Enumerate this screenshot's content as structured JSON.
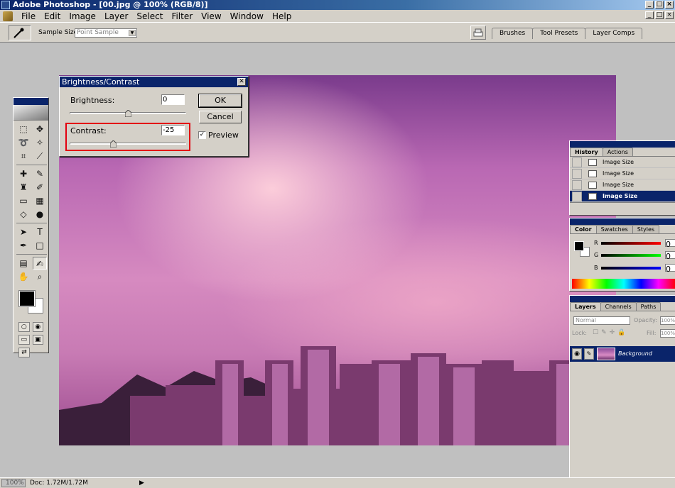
{
  "app": {
    "title": "Adobe Photoshop - [00.jpg @ 100% (RGB/8)]",
    "window_buttons": [
      "_",
      "□",
      "×"
    ],
    "mdi_buttons": [
      "_",
      "□",
      "×"
    ]
  },
  "menu": [
    "File",
    "Edit",
    "Image",
    "Layer",
    "Select",
    "Filter",
    "View",
    "Window",
    "Help"
  ],
  "options_bar": {
    "sample_size_label": "Sample Size:",
    "sample_size_value": "Point Sample",
    "well_tabs": [
      "Brushes",
      "Tool Presets",
      "Layer Comps"
    ]
  },
  "dialog": {
    "title": "Brightness/Contrast",
    "brightness_label": "Brightness:",
    "brightness_value": "0",
    "contrast_label": "Contrast:",
    "contrast_value": "-25",
    "ok_label": "OK",
    "cancel_label": "Cancel",
    "preview_label": "Preview",
    "preview_checked": true,
    "brightness_slider_fraction": 0.5,
    "contrast_slider_fraction": 0.375,
    "highlight_color": "#e3000f"
  },
  "history_panel": {
    "tabs": [
      "History",
      "Actions"
    ],
    "items": [
      "Image Size",
      "Image Size",
      "Image Size",
      "Image Size"
    ],
    "selected_index": 3
  },
  "color_panel": {
    "tabs": [
      "Color",
      "Swatches",
      "Styles"
    ],
    "channels": [
      "R",
      "G",
      "B"
    ],
    "values": [
      "0",
      "0",
      "0"
    ]
  },
  "layers_panel": {
    "tabs": [
      "Layers",
      "Channels",
      "Paths"
    ],
    "blend_mode": "Normal",
    "opacity_label": "Opacity:",
    "opacity_value": "100%",
    "lock_label": "Lock:",
    "fill_label": "Fill:",
    "fill_value": "100%",
    "layer_name": "Background"
  },
  "status_bar": {
    "zoom": "100%",
    "doc_info": "Doc: 1.72M/1.72M"
  },
  "colors": {
    "titlebar": "#0a246a",
    "foreground": "#000000",
    "background": "#ffffff"
  }
}
